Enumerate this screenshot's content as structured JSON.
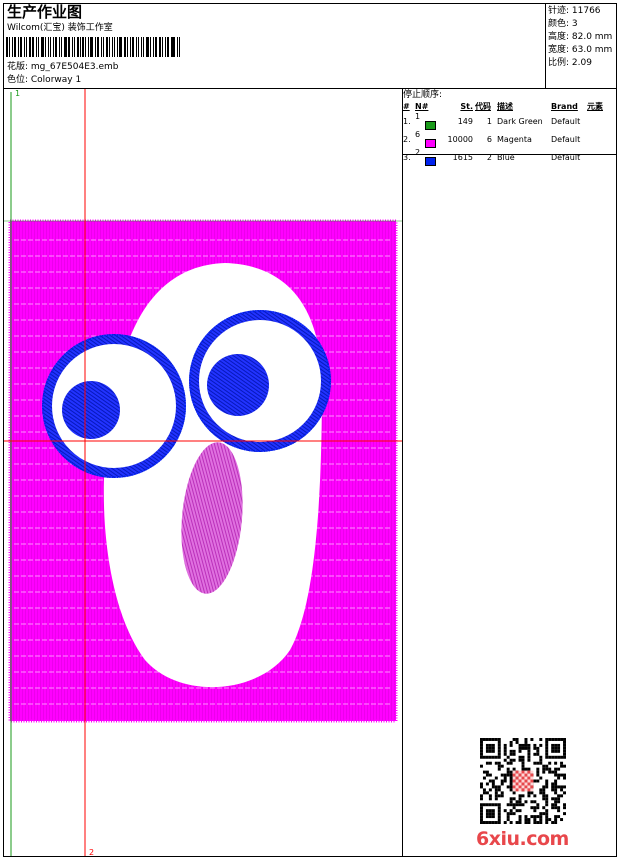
{
  "header": {
    "title": "生产作业图",
    "studio": "Wilcom(汇宝) 装饰工作室",
    "design_line": "花版: mg_67E504E3.emb",
    "colorway_line": "色位: Colorway 1"
  },
  "stats": {
    "stitches": "针迹: 11766",
    "colors": "颜色: 3",
    "height": "高度: 82.0 mm",
    "width": "宽度: 63.0 mm",
    "scale": "比例: 2.09"
  },
  "stop_sequence": {
    "label": "停止顺序:",
    "headers": [
      "#",
      "N#",
      "St.",
      "代码",
      "描述",
      "Brand",
      "元素"
    ],
    "rows": [
      {
        "idx": "1.",
        "needle": "1",
        "color": "#1a9a1a",
        "stitches": "149",
        "code": "1",
        "desc": "Dark Green",
        "brand": "Default"
      },
      {
        "idx": "2.",
        "needle": "6",
        "color": "#ff00ff",
        "stitches": "10000",
        "code": "6",
        "desc": "Magenta",
        "brand": "Default"
      },
      {
        "idx": "3.",
        "needle": "2",
        "color": "#0022ee",
        "stitches": "1615",
        "code": "2",
        "desc": "Blue",
        "brand": "Default"
      }
    ]
  },
  "canvas": {
    "marker_1": "1",
    "marker_2": "2",
    "colors": {
      "background": "#ff00ff",
      "face": "#ffffff",
      "eyes": "#0022ee",
      "guides": "#ff0000",
      "green_guide": "#1a9a1a"
    }
  },
  "watermark": {
    "brand": "6xiu.com"
  }
}
